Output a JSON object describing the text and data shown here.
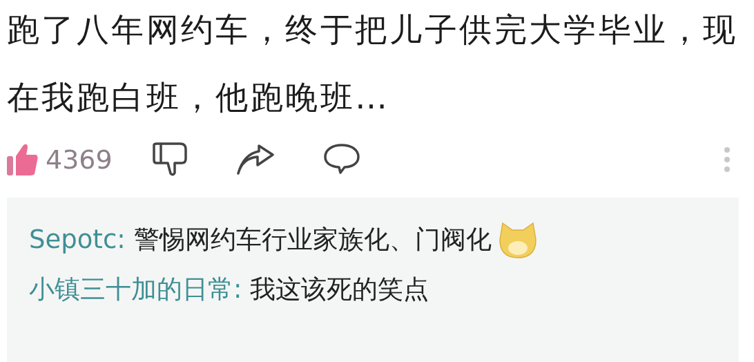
{
  "post": {
    "text": "跑了八年网约车，终于把儿子供完大学毕业，现在我跑白班，他跑晚班…"
  },
  "actions": {
    "likes": "4369",
    "liked": true
  },
  "replies": [
    {
      "author": "Sepotc:",
      "text": "警惕网约车行业家族化、门阀化",
      "emoji": true
    },
    {
      "author": "小镇三十加的日常:",
      "text": "我这该死的笑点",
      "emoji": false
    }
  ]
}
